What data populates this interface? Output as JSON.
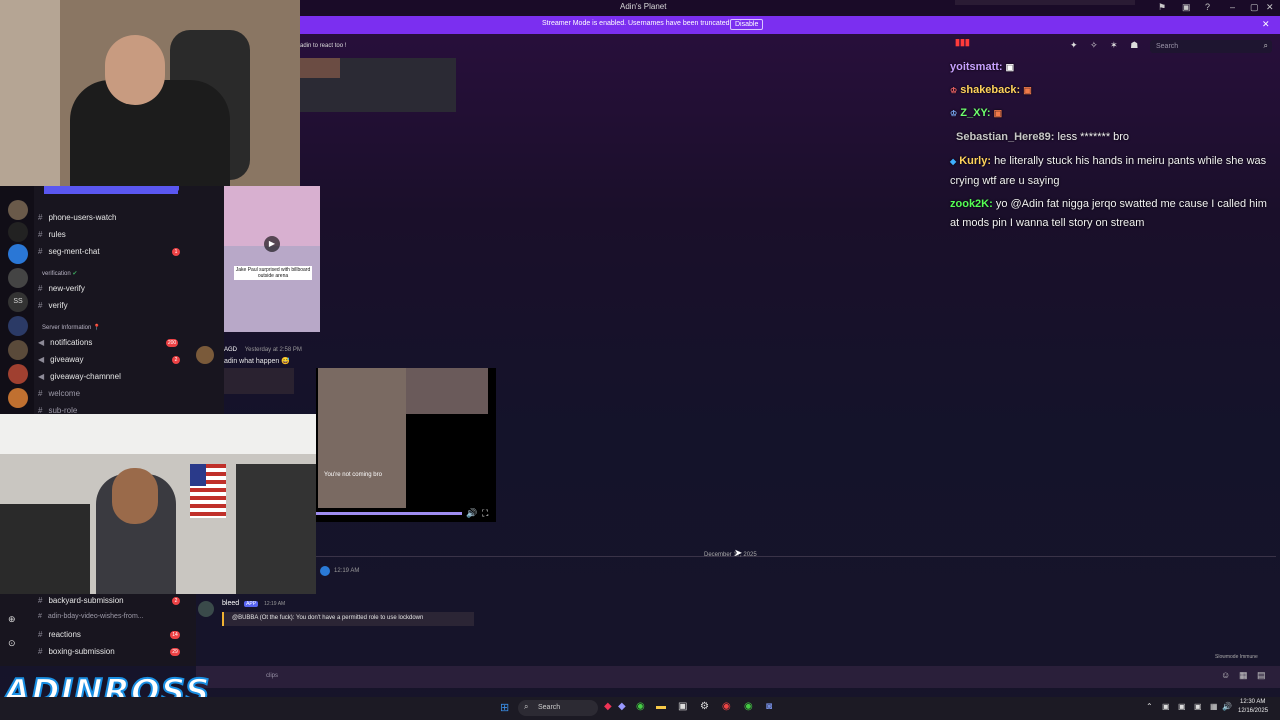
{
  "window": {
    "title": "Adin's Planet"
  },
  "banner": {
    "message": "Streamer Mode is enabled. Usernames have been truncated.",
    "button": "Disable"
  },
  "header": {
    "search_placeholder": "Search"
  },
  "chat": [
    {
      "user": "yoitsmatt:",
      "message": "",
      "color": "#c7a0ff"
    },
    {
      "user": "shakeback:",
      "message": "",
      "color": "#ffd35c"
    },
    {
      "user": "Z_XY:",
      "message": "",
      "color": "#6fff6f"
    },
    {
      "user": "Sebastian_Here89:",
      "message": "less ******* bro",
      "color": "#c6c6c6"
    },
    {
      "user": "Kurly:",
      "message": "he literally stuck his hands in meiru pants while she was",
      "color": "#ffd35c"
    },
    {
      "line2": "crying wtf are u saying"
    },
    {
      "user": "zook2K:",
      "message": "yo @Adin fat nigga jerqo swatted me cause I called him",
      "color": "#55ff55"
    },
    {
      "line2": "at mods pin I wanna tell story on stream"
    }
  ],
  "sidebar": {
    "channels": [
      {
        "name": "phone-users-watch"
      },
      {
        "name": "rules"
      },
      {
        "name": "seg-ment-chat"
      },
      {
        "name": "new-verify"
      },
      {
        "name": "verify"
      },
      {
        "name": "notifications"
      },
      {
        "name": "giveaway"
      },
      {
        "name": "giveaway-chamnnel"
      },
      {
        "name": "welcome"
      },
      {
        "name": "sub-role"
      }
    ],
    "categories": {
      "verification": "verification",
      "server_info": "Server Information"
    },
    "lower_channels": [
      {
        "name": "backyard-submission"
      },
      {
        "name": "adin-bday-video-wishes-from..."
      },
      {
        "name": "reactions"
      },
      {
        "name": "boxing-submission"
      }
    ]
  },
  "messages": {
    "top_text": "adin to react too !",
    "agd_user": "AGD",
    "agd_time": "Yesterday at 2:58 PM",
    "agd_text": "adin what happen",
    "video_caption": "Jake Paul surprised with billboard outside arena",
    "clip_caption": "You're not coming bro",
    "date_divider": "December 17, 2025",
    "time_1219": "12:19 AM",
    "bleed_user": "bleed",
    "bleed_tag": "APP",
    "bleed_time": "12:19 AM",
    "bleed_text": "@BUBBA (Ot the fuck): You don't have a permitted role to use lockdown",
    "slowmode": "Slowmode Immune",
    "input_placeholder": "clips"
  },
  "overlay": {
    "logo": "ADINROSS"
  },
  "taskbar": {
    "search": "Search",
    "time": "12:30 AM",
    "date": "12/16/2025"
  },
  "colors": {
    "accent": "#7b2ff0",
    "discord_bg": "#18151f"
  }
}
